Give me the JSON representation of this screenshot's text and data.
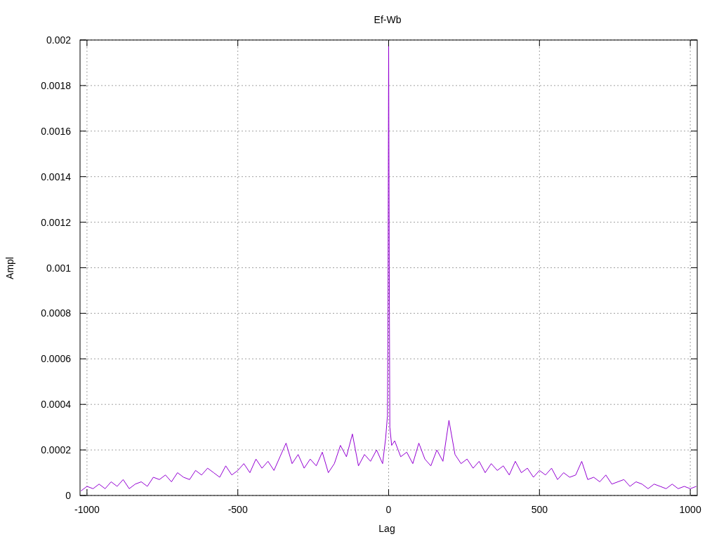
{
  "chart_data": {
    "type": "line",
    "title": "Ef-Wb",
    "xlabel": "Lag",
    "ylabel": "Ampl",
    "xlim": [
      -1023,
      1023
    ],
    "ylim": [
      0,
      0.002
    ],
    "grid": true,
    "xticks": [
      -1000,
      -500,
      0,
      500,
      1000
    ],
    "yticks": [
      0,
      0.0002,
      0.0004,
      0.0006,
      0.0008,
      0.001,
      0.0012,
      0.0014,
      0.0016,
      0.0018,
      0.002
    ],
    "x": [
      -1020,
      -1000,
      -980,
      -960,
      -940,
      -920,
      -900,
      -880,
      -860,
      -840,
      -820,
      -800,
      -780,
      -760,
      -740,
      -720,
      -700,
      -680,
      -660,
      -640,
      -620,
      -600,
      -580,
      -560,
      -540,
      -520,
      -500,
      -480,
      -460,
      -440,
      -420,
      -400,
      -380,
      -360,
      -340,
      -320,
      -300,
      -280,
      -260,
      -240,
      -220,
      -200,
      -180,
      -160,
      -140,
      -120,
      -100,
      -80,
      -60,
      -40,
      -20,
      -10,
      -4,
      -2,
      0,
      2,
      4,
      10,
      20,
      40,
      60,
      80,
      100,
      120,
      140,
      160,
      180,
      200,
      220,
      240,
      260,
      280,
      300,
      320,
      340,
      360,
      380,
      400,
      420,
      440,
      460,
      480,
      500,
      520,
      540,
      560,
      580,
      600,
      620,
      640,
      660,
      680,
      700,
      720,
      740,
      760,
      780,
      800,
      820,
      840,
      860,
      880,
      900,
      920,
      940,
      960,
      980,
      1000,
      1020
    ],
    "series": [
      {
        "color": "#9400d3",
        "values": [
          2e-05,
          4e-05,
          3e-05,
          5e-05,
          3e-05,
          6e-05,
          4e-05,
          7e-05,
          3e-05,
          5e-05,
          6e-05,
          4e-05,
          8e-05,
          7e-05,
          9e-05,
          6e-05,
          0.0001,
          8e-05,
          7e-05,
          0.00011,
          9e-05,
          0.00012,
          0.0001,
          8e-05,
          0.00013,
          9e-05,
          0.00011,
          0.00014,
          0.0001,
          0.00016,
          0.00012,
          0.00015,
          0.00011,
          0.00017,
          0.00023,
          0.00014,
          0.00018,
          0.00012,
          0.00016,
          0.00013,
          0.00019,
          0.0001,
          0.00014,
          0.00022,
          0.00017,
          0.00027,
          0.00013,
          0.00018,
          0.00015,
          0.0002,
          0.00014,
          0.00025,
          0.00035,
          0.00083,
          0.002,
          0.00101,
          0.0003,
          0.00022,
          0.00024,
          0.00017,
          0.00019,
          0.00014,
          0.00023,
          0.00016,
          0.00013,
          0.0002,
          0.00015,
          0.00033,
          0.00018,
          0.00014,
          0.00016,
          0.00012,
          0.00015,
          0.0001,
          0.00014,
          0.00011,
          0.00013,
          9e-05,
          0.00015,
          0.0001,
          0.00012,
          8e-05,
          0.00011,
          9e-05,
          0.00012,
          7e-05,
          0.0001,
          8e-05,
          9e-05,
          0.00015,
          7e-05,
          8e-05,
          6e-05,
          9e-05,
          5e-05,
          6e-05,
          7e-05,
          4e-05,
          6e-05,
          5e-05,
          3e-05,
          5e-05,
          4e-05,
          3e-05,
          5e-05,
          3e-05,
          4e-05,
          3e-05,
          4e-05
        ]
      }
    ]
  }
}
